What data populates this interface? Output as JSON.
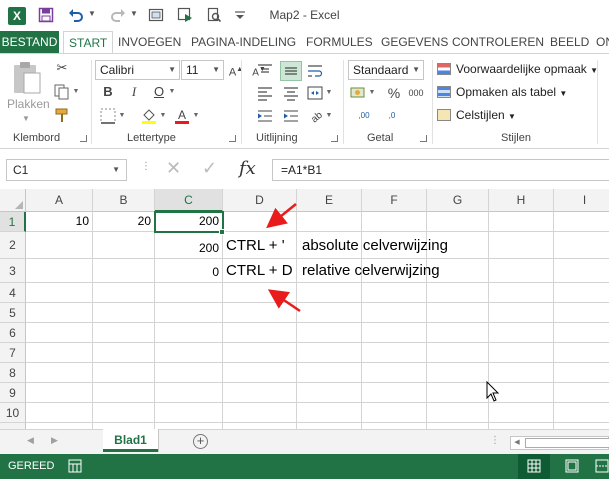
{
  "window": {
    "title": "Map2 - Excel",
    "app_icon_letter": "X",
    "accent_color": "#217346"
  },
  "quick_access": {
    "icons": [
      "save-icon",
      "undo-icon",
      "redo-icon",
      "camera-icon",
      "slideshow-icon",
      "print-preview-icon",
      "customize-icon"
    ]
  },
  "tabs": {
    "file": "BESTAND",
    "items": [
      "START",
      "INVOEGEN",
      "PAGINA-INDELING",
      "FORMULES",
      "GEGEVENS",
      "CONTROLEREN",
      "BEELD",
      "ON"
    ],
    "active": "START"
  },
  "ribbon": {
    "clipboard": {
      "label": "Klembord",
      "paste_label": "Plakken"
    },
    "font": {
      "label": "Lettertype",
      "font_name": "Calibri",
      "font_size": "11",
      "bold": "B",
      "italic": "I",
      "underline": "O"
    },
    "alignment": {
      "label": "Uitlijning"
    },
    "number": {
      "label": "Getal",
      "format": "Standaard",
      "percent": "%",
      "thousands": "000",
      "comma_inc": ",00",
      "comma_dec": ",0"
    },
    "styles": {
      "label": "Stijlen",
      "conditional": "Voorwaardelijke opmaak",
      "table": "Opmaken als tabel",
      "cell_styles": "Celstijlen"
    }
  },
  "formula_bar": {
    "name_box": "C1",
    "fx": "fx",
    "formula": "=A1*B1"
  },
  "grid": {
    "columns": [
      "A",
      "B",
      "C",
      "D",
      "E",
      "F",
      "G",
      "H",
      "I"
    ],
    "selected_column": "C",
    "rows": [
      "1",
      "2",
      "3",
      "4",
      "5",
      "6",
      "7",
      "8",
      "9",
      "10"
    ],
    "selected_row": "1",
    "cells": {
      "A1": "10",
      "B1": "20",
      "C1": "200",
      "C2": "200",
      "D2": "CTRL + '",
      "E2": "absolute celverwijzing",
      "C3": "0",
      "D3": "CTRL + D",
      "E3": "relative celverwijzing"
    },
    "selected_cell": "C1"
  },
  "sheets": {
    "active": "Blad1"
  },
  "status": {
    "text": "GEREED"
  },
  "annotations": {
    "arrow_color": "#e81c1c"
  }
}
